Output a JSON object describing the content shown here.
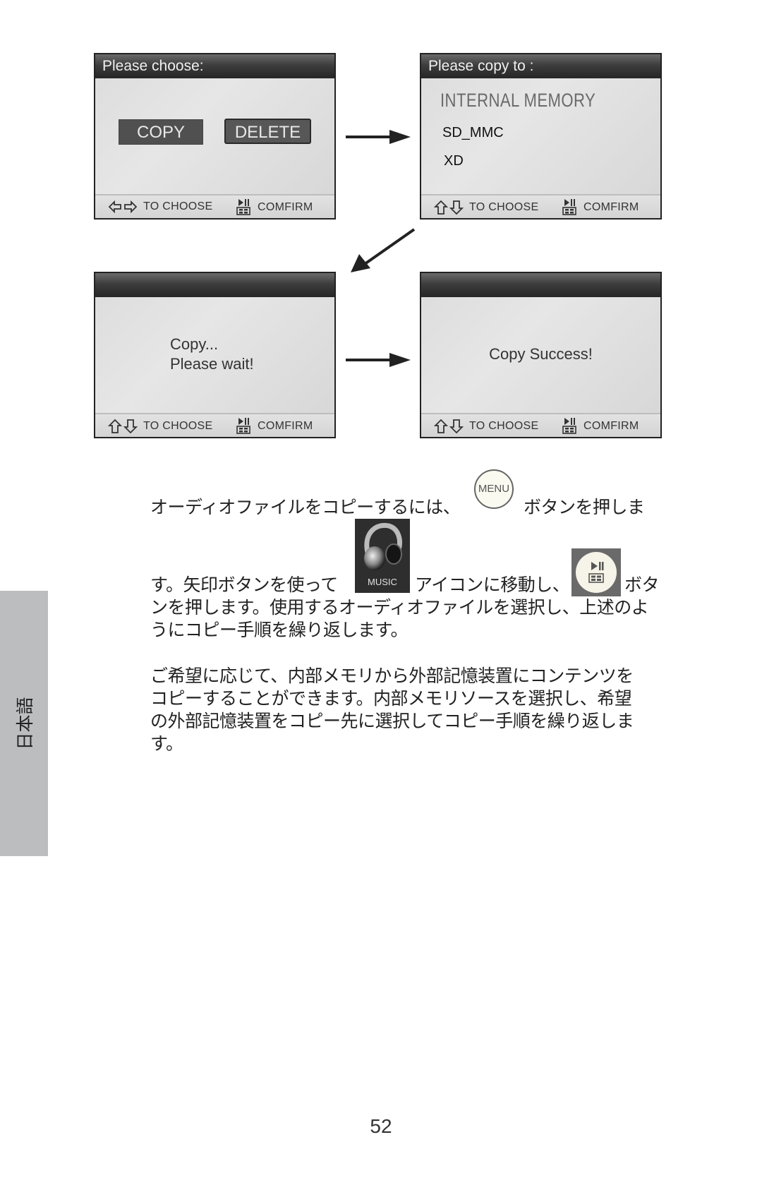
{
  "screens": [
    {
      "title": "Please choose:",
      "buttons": [
        "COPY",
        "DELETE"
      ],
      "footer": {
        "nav_icons": [
          "left-arrow-icon",
          "right-arrow-icon"
        ],
        "nav_label": "TO CHOOSE",
        "confirm_label": "COMFIRM"
      }
    },
    {
      "title": "Please copy to :",
      "options": [
        "INTERNAL MEMORY",
        "SD_MMC",
        "XD"
      ],
      "footer": {
        "nav_icons": [
          "up-arrow-icon",
          "down-arrow-icon"
        ],
        "nav_label": "TO CHOOSE",
        "confirm_label": "COMFIRM"
      }
    },
    {
      "title": "",
      "message_lines": [
        "Copy...",
        "Please wait!"
      ],
      "footer": {
        "nav_icons": [
          "up-arrow-icon",
          "down-arrow-icon"
        ],
        "nav_label": "TO CHOOSE",
        "confirm_label": "COMFIRM"
      }
    },
    {
      "title": "",
      "message": "Copy Success!",
      "footer": {
        "nav_icons": [
          "up-arrow-icon",
          "down-arrow-icon"
        ],
        "nav_label": "TO CHOOSE",
        "confirm_label": "COMFIRM"
      }
    }
  ],
  "flow_arrows": [
    "right",
    "down-left",
    "right"
  ],
  "paragraph1": {
    "line1_a": "オーディオファイルをコピーするには、",
    "menu_button_label": "MENU",
    "line1_b": "ボタンを押しま",
    "line2_a": "す。矢印ボタンを使って",
    "music_icon_label": "MUSIC",
    "line2_b": "アイコンに移動し、",
    "line2_c": "ボタ",
    "line3": "ンを押します。使用するオーディオファイルを選択し、上述のよ",
    "line4": "うにコピー手順を繰り返します。"
  },
  "paragraph2": {
    "lines": [
      "ご希望に応じて、内部メモリから外部記憶装置にコンテンツを",
      "コピーすることができます。内部メモリソースを選択し、希望",
      "の外部記憶装置をコピー先に選択してコピー手順を繰り返しま",
      "す。"
    ]
  },
  "side_tab": {
    "label": "日本語"
  },
  "page_number": "52"
}
